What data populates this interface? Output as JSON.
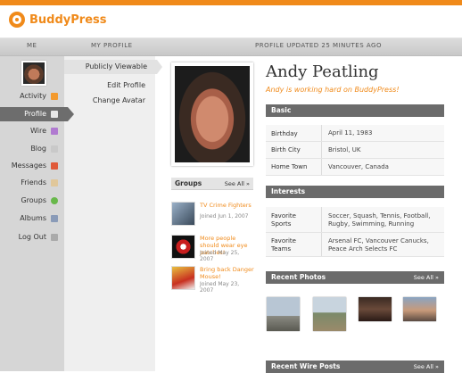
{
  "brand": {
    "name": "BuddyPress",
    "color": "#f08a1a"
  },
  "columns": {
    "me": "ME",
    "my_profile": "MY PROFILE",
    "updated": "PROFILE UPDATED 25 MINUTES AGO"
  },
  "nav": [
    {
      "label": "Activity",
      "icon": "rss-icon",
      "color": "#f39a2e"
    },
    {
      "label": "Profile",
      "icon": "profile-card-icon",
      "color": "#e8e8e8",
      "active": true
    },
    {
      "label": "Wire",
      "icon": "wire-icon",
      "color": "#b07ad0"
    },
    {
      "label": "Blog",
      "icon": "blog-icon",
      "color": "#c9c9c9"
    },
    {
      "label": "Messages",
      "icon": "messages-icon",
      "color": "#e05a3a"
    },
    {
      "label": "Friends",
      "icon": "friends-icon",
      "color": "#e0c79a"
    },
    {
      "label": "Groups",
      "icon": "groups-icon",
      "color": "#68b84a"
    },
    {
      "label": "Albums",
      "icon": "albums-icon",
      "color": "#8a9bb8"
    },
    {
      "label": "Log Out",
      "icon": "lock-icon",
      "color": "#aaaaaa"
    }
  ],
  "subnav": [
    {
      "label": "Publicly Viewable",
      "active": true
    },
    {
      "label": "Edit Profile"
    },
    {
      "label": "Change Avatar"
    }
  ],
  "profile": {
    "name": "Andy Peatling",
    "status": "Andy is working hard on BuddyPress!"
  },
  "basic": {
    "title": "Basic",
    "rows": [
      {
        "key": "Birthday",
        "value": "April 11, 1983"
      },
      {
        "key": "Birth City",
        "value": "Bristol, UK"
      },
      {
        "key": "Home Town",
        "value": "Vancouver, Canada"
      }
    ]
  },
  "interests": {
    "title": "Interests",
    "rows": [
      {
        "key": "Favorite Sports",
        "value": "Soccer, Squash, Tennis, Football, Rugby, Swimming, Running"
      },
      {
        "key": "Favorite Teams",
        "value": "Arsenal FC, Vancouver Canucks, Peace Arch Selects FC"
      }
    ]
  },
  "groups": {
    "title": "Groups",
    "see_all": "See All »",
    "items": [
      {
        "name": "TV Crime Fighters",
        "joined": "Joined Jun 1, 2007"
      },
      {
        "name": "More people should wear eye patches!",
        "joined": "Joined May 25, 2007"
      },
      {
        "name": "Bring back Danger Mouse!",
        "joined": "Joined May 23, 2007"
      }
    ]
  },
  "recent_photos": {
    "title": "Recent Photos",
    "see_all": "See All »"
  },
  "recent_wire": {
    "title": "Recent Wire Posts",
    "see_all": "See All »"
  }
}
